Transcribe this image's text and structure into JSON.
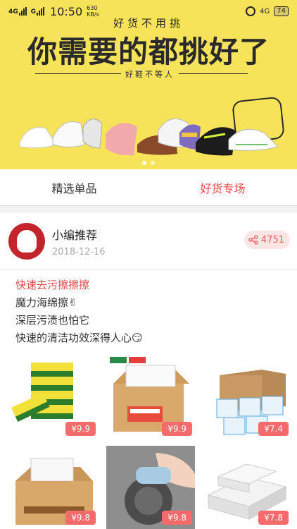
{
  "status": {
    "network1": "4G",
    "network2": "G",
    "time": "10:50",
    "speed_value": "630",
    "speed_unit": "KB/s",
    "network3": "4G",
    "battery": "74"
  },
  "banner": {
    "subtitle": "好货不用挑",
    "title": "你需要的都挑好了",
    "tagline": "好鞋不等人",
    "active_slide": 1
  },
  "tabs": [
    {
      "label": "精选单品",
      "active": false
    },
    {
      "label": "好货专场",
      "active": true
    }
  ],
  "post": {
    "author_name": "小编推荐",
    "date": "2018-12-16",
    "share_count": "4751",
    "lines": [
      "快速去污擦擦擦",
      "魔力海绵擦✌",
      "深层污渍也怕它",
      "快速的清洁功效深得人心😏"
    ],
    "products": [
      {
        "price": "¥9.9",
        "icon": "yellow-green-sponge"
      },
      {
        "price": "¥9.9",
        "icon": "sponge-box"
      },
      {
        "price": "¥7.4",
        "icon": "sponge-packs"
      },
      {
        "price": "¥9.8",
        "icon": "nano-sponge-box"
      },
      {
        "price": "¥9.8",
        "icon": "hand-cleaning-stove"
      },
      {
        "price": "¥7.8",
        "icon": "white-sponge-blocks"
      }
    ]
  },
  "colors": {
    "banner_bg": "#f7e35a",
    "accent": "#f04848",
    "price_bg": "#f56a6a"
  }
}
